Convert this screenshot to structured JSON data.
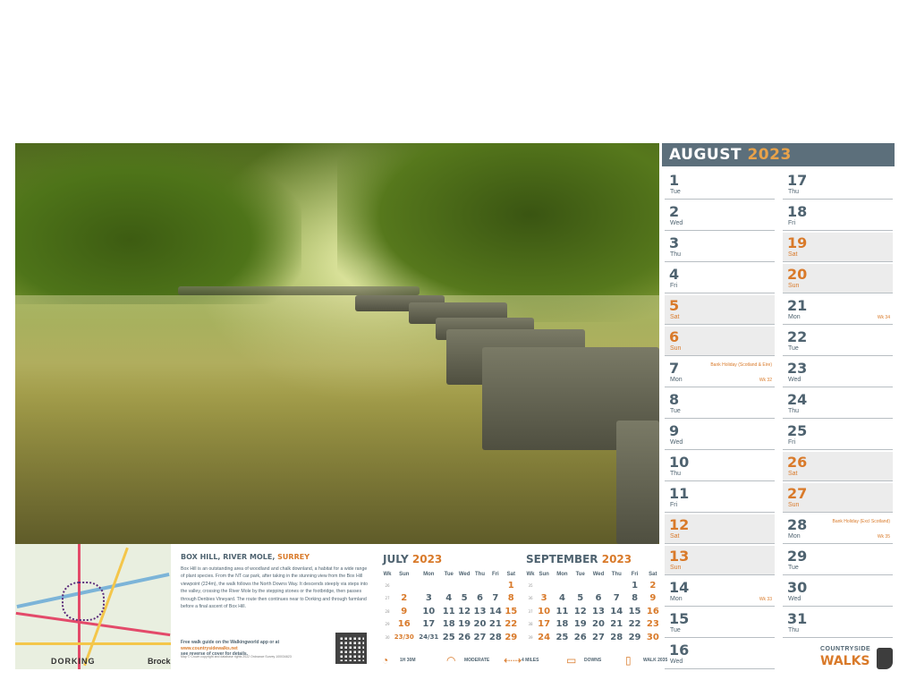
{
  "august": {
    "month": "AUGUST",
    "year": "2023",
    "days": [
      {
        "n": "1",
        "d": "Tue",
        "we": false
      },
      {
        "n": "2",
        "d": "Wed",
        "we": false
      },
      {
        "n": "3",
        "d": "Thu",
        "we": false
      },
      {
        "n": "4",
        "d": "Fri",
        "we": false
      },
      {
        "n": "5",
        "d": "Sat",
        "we": true
      },
      {
        "n": "6",
        "d": "Sun",
        "we": true
      },
      {
        "n": "7",
        "d": "Mon",
        "we": false,
        "note": "Bank Holiday (Scotland & Eire)",
        "wk": "Wk 32"
      },
      {
        "n": "8",
        "d": "Tue",
        "we": false
      },
      {
        "n": "9",
        "d": "Wed",
        "we": false
      },
      {
        "n": "10",
        "d": "Thu",
        "we": false
      },
      {
        "n": "11",
        "d": "Fri",
        "we": false
      },
      {
        "n": "12",
        "d": "Sat",
        "we": true
      },
      {
        "n": "13",
        "d": "Sun",
        "we": true
      },
      {
        "n": "14",
        "d": "Mon",
        "we": false,
        "wk": "Wk 33"
      },
      {
        "n": "15",
        "d": "Tue",
        "we": false
      },
      {
        "n": "16",
        "d": "Wed",
        "we": false
      },
      {
        "n": "17",
        "d": "Thu",
        "we": false
      },
      {
        "n": "18",
        "d": "Fri",
        "we": false
      },
      {
        "n": "19",
        "d": "Sat",
        "we": true
      },
      {
        "n": "20",
        "d": "Sun",
        "we": true
      },
      {
        "n": "21",
        "d": "Mon",
        "we": false,
        "wk": "Wk 34"
      },
      {
        "n": "22",
        "d": "Tue",
        "we": false
      },
      {
        "n": "23",
        "d": "Wed",
        "we": false
      },
      {
        "n": "24",
        "d": "Thu",
        "we": false
      },
      {
        "n": "25",
        "d": "Fri",
        "we": false
      },
      {
        "n": "26",
        "d": "Sat",
        "we": true
      },
      {
        "n": "27",
        "d": "Sun",
        "we": true
      },
      {
        "n": "28",
        "d": "Mon",
        "we": false,
        "note": "Bank Holiday (Excl Scotland)",
        "wk": "Wk 35"
      },
      {
        "n": "29",
        "d": "Tue",
        "we": false
      },
      {
        "n": "30",
        "d": "Wed",
        "we": false
      },
      {
        "n": "31",
        "d": "Thu",
        "we": false
      }
    ]
  },
  "walk": {
    "place": "BOX HILL, RIVER MOLE, ",
    "county": "SURREY",
    "description": "Box Hill is an outstanding area of woodland and chalk downland, a habitat for a wide range of plant species. From the NT car park, after taking in the stunning view from the Box Hill viewpoint (224m), the walk follows the North Downs Way. It descends steeply via steps into the valley, crossing the River Mole by the stepping stones or the footbridge, then passes through Denbies Vineyard. The route then continues near to Dorking and through farmland before a final ascent of Box Hill.",
    "guide_text": "Free walk guide on the Walkingworld app or at ",
    "guide_url": "www.countrysidewalks.net",
    "guide_text2": "see reverse of cover for details.",
    "copyright": "Map © Crown copyright and database rights 2022 Ordnance Survey 100034623"
  },
  "map": {
    "town": "DORKING",
    "town2": "Brock"
  },
  "july": {
    "month": "JULY",
    "year": "2023",
    "headers": [
      "Wk",
      "Sun",
      "Mon",
      "Tue",
      "Wed",
      "Thu",
      "Fri",
      "Sat"
    ],
    "rows": [
      [
        "26",
        "",
        "",
        "",
        "",
        "",
        "",
        "1"
      ],
      [
        "27",
        "2",
        "3",
        "4",
        "5",
        "6",
        "7",
        "8"
      ],
      [
        "28",
        "9",
        "10",
        "11",
        "12",
        "13",
        "14",
        "15"
      ],
      [
        "29",
        "16",
        "17",
        "18",
        "19",
        "20",
        "21",
        "22"
      ],
      [
        "30",
        "23/30",
        "24/31",
        "25",
        "26",
        "27",
        "28",
        "29"
      ]
    ]
  },
  "september": {
    "month": "SEPTEMBER",
    "year": "2023",
    "headers": [
      "Wk",
      "Sun",
      "Mon",
      "Tue",
      "Wed",
      "Thu",
      "Fri",
      "Sat"
    ],
    "rows": [
      [
        "35",
        "",
        "",
        "",
        "",
        "",
        "1",
        "2"
      ],
      [
        "36",
        "3",
        "4",
        "5",
        "6",
        "7",
        "8",
        "9"
      ],
      [
        "37",
        "10",
        "11",
        "12",
        "13",
        "14",
        "15",
        "16"
      ],
      [
        "38",
        "17",
        "18",
        "19",
        "20",
        "21",
        "22",
        "23"
      ],
      [
        "39",
        "24",
        "25",
        "26",
        "27",
        "28",
        "29",
        "30"
      ]
    ]
  },
  "stats": [
    {
      "icon": "◔",
      "icon_name": "clock-icon",
      "label": "1H 30M"
    },
    {
      "icon": "◠",
      "icon_name": "gauge-icon",
      "label": "MODERATE"
    },
    {
      "icon": "⇠⇢",
      "icon_name": "distance-arrows-icon",
      "label": "4 MILES"
    },
    {
      "icon": "▭",
      "icon_name": "terrain-icon",
      "label": "DOWNS"
    },
    {
      "icon": "▯",
      "icon_name": "phone-icon",
      "label": "WALK 2035"
    }
  ],
  "logo": {
    "line1": "COUNTRYSIDE",
    "line2": "WALKS"
  },
  "colors": {
    "accent": "#d97a2a",
    "slate": "#5c6f7b"
  }
}
